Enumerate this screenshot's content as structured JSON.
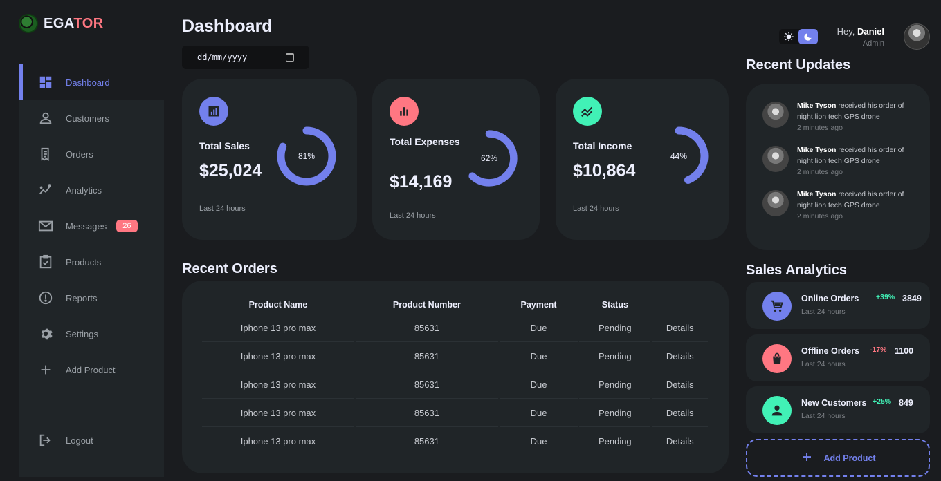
{
  "brand": {
    "part1": "EGA",
    "part2": "TOR"
  },
  "sidebar": {
    "items": [
      {
        "label": "Dashboard",
        "icon": "grid-icon"
      },
      {
        "label": "Customers",
        "icon": "person-icon"
      },
      {
        "label": "Orders",
        "icon": "receipt-icon"
      },
      {
        "label": "Analytics",
        "icon": "insights-icon"
      },
      {
        "label": "Messages",
        "icon": "mail-icon",
        "count": "26"
      },
      {
        "label": "Products",
        "icon": "clipboard-check-icon"
      },
      {
        "label": "Reports",
        "icon": "report-icon"
      },
      {
        "label": "Settings",
        "icon": "gear-icon"
      },
      {
        "label": "Add Product",
        "icon": "plus-icon"
      },
      {
        "label": "Logout",
        "icon": "logout-icon"
      }
    ]
  },
  "header": {
    "title": "Dashboard",
    "date_placeholder": "dd/mm/yyyy"
  },
  "insights": [
    {
      "title": "Total Sales",
      "value": "$25,024",
      "percent": "81%",
      "fraction": 0.81,
      "footer": "Last 24 hours",
      "icon": "bar-chart-icon",
      "color": "#7380ec"
    },
    {
      "title": "Total Expenses",
      "value": "$14,169",
      "percent": "62%",
      "fraction": 0.62,
      "footer": "Last 24 hours",
      "icon": "bar-chart-icon",
      "color": "#ff7782"
    },
    {
      "title": "Total Income",
      "value": "$10,864",
      "percent": "44%",
      "fraction": 0.44,
      "footer": "Last 24 hours",
      "icon": "stocks-icon",
      "color": "#41f1b6"
    }
  ],
  "orders": {
    "title": "Recent Orders",
    "headers": [
      "Product Name",
      "Product Number",
      "Payment",
      "Status"
    ],
    "rows": [
      {
        "name": "Iphone 13 pro max",
        "number": "85631",
        "payment": "Due",
        "status": "Pending",
        "action": "Details"
      },
      {
        "name": "Iphone 13 pro max",
        "number": "85631",
        "payment": "Due",
        "status": "Pending",
        "action": "Details"
      },
      {
        "name": "Iphone 13 pro max",
        "number": "85631",
        "payment": "Due",
        "status": "Pending",
        "action": "Details"
      },
      {
        "name": "Iphone 13 pro max",
        "number": "85631",
        "payment": "Due",
        "status": "Pending",
        "action": "Details"
      },
      {
        "name": "Iphone 13 pro max",
        "number": "85631",
        "payment": "Due",
        "status": "Pending",
        "action": "Details"
      }
    ]
  },
  "profile": {
    "greeting": "Hey,",
    "name": "Daniel",
    "role": "Admin"
  },
  "updates": {
    "title": "Recent Updates",
    "items": [
      {
        "name": "Mike Tyson",
        "text": "received his order of night lion tech GPS drone",
        "time": "2 minutes ago"
      },
      {
        "name": "Mike Tyson",
        "text": "received his order of night lion tech GPS drone",
        "time": "2 minutes ago"
      },
      {
        "name": "Mike Tyson",
        "text": "received his order of night lion tech GPS drone",
        "time": "2 minutes ago"
      }
    ]
  },
  "sales": {
    "title": "Sales Analytics",
    "items": [
      {
        "title": "Online Orders",
        "sub": "Last 24 hours",
        "pct": "+39%",
        "value": "3849",
        "icon": "cart-icon",
        "color": "#7380ec",
        "pct_color": "#41f1b6"
      },
      {
        "title": "Offline Orders",
        "sub": "Last 24 hours",
        "pct": "-17%",
        "value": "1100",
        "icon": "shopping-bag-icon",
        "color": "#ff7782",
        "pct_color": "#ff7782"
      },
      {
        "title": "New Customers",
        "sub": "Last 24 hours",
        "pct": "+25%",
        "value": "849",
        "icon": "person-icon",
        "color": "#41f1b6",
        "pct_color": "#41f1b6"
      }
    ],
    "add_label": "Add Product"
  }
}
